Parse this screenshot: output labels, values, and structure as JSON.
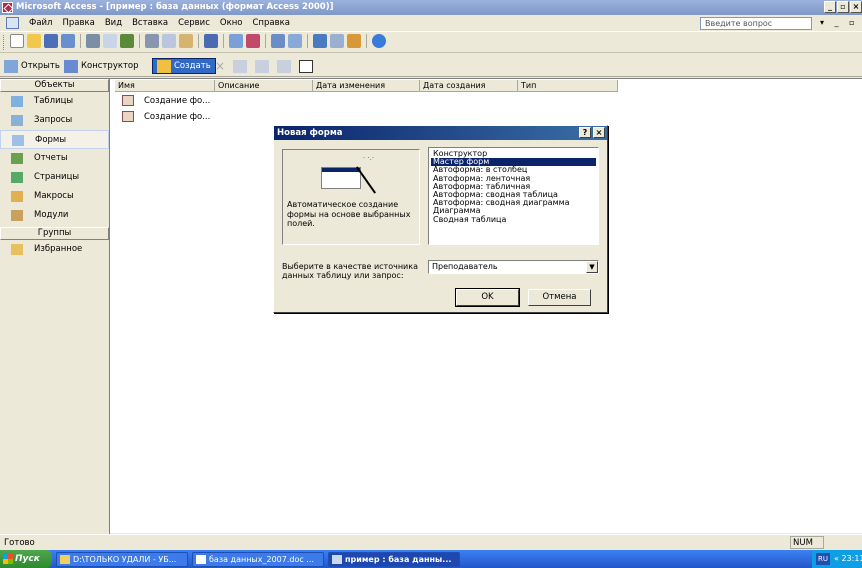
{
  "window": {
    "title": "Microsoft Access - [пример : база данных (формат Access 2000)]",
    "controls": [
      "_",
      "▫",
      "×"
    ]
  },
  "menu": {
    "items": [
      "Файл",
      "Правка",
      "Вид",
      "Вставка",
      "Сервис",
      "Окно",
      "Справка"
    ],
    "help_placeholder": "Введите вопрос"
  },
  "db_toolbar": {
    "open": "Открыть",
    "design": "Конструктор",
    "create": "Создать"
  },
  "objects": {
    "header": "Объекты",
    "items": [
      "Таблицы",
      "Запросы",
      "Формы",
      "Отчеты",
      "Страницы",
      "Макросы",
      "Модули"
    ],
    "selected_index": 2,
    "groups_header": "Группы",
    "favorites": "Избранное"
  },
  "list": {
    "columns": [
      "Имя",
      "Описание",
      "Дата изменения",
      "Дата создания",
      "Тип"
    ],
    "rows": [
      "Создание фо...",
      "Создание фо..."
    ]
  },
  "dialog": {
    "title": "Новая форма",
    "help_btn": "?",
    "close_btn": "×",
    "description": "Автоматическое создание формы на основе выбранных полей.",
    "options": [
      "Конструктор",
      "Мастер форм",
      "Автоформа: в столбец",
      "Автоформа: ленточная",
      "Автоформа: табличная",
      "Автоформа:  сводная таблица",
      "Автоформа:  сводная диаграмма",
      "Диаграмма",
      "Сводная таблица"
    ],
    "selected_option": 1,
    "source_prompt": "Выберите в качестве источника данных таблицу или запрос:",
    "source_value": "Преподаватель",
    "ok": "OK",
    "cancel": "Отмена"
  },
  "status": {
    "text": "Готово",
    "num": "NUM"
  },
  "taskbar": {
    "start": "Пуск",
    "tasks": [
      "D:\\ТОЛЬКО УДАЛИ - УБ...",
      "база данных_2007.doc ...",
      "пример : база данны..."
    ],
    "lang": "RU",
    "clock": "« 23:11"
  }
}
